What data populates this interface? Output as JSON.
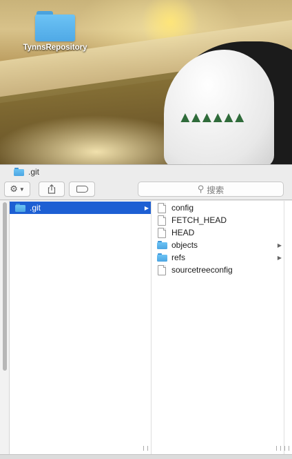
{
  "desktop": {
    "folder_label": "TynnsRepository"
  },
  "window": {
    "title": ".git",
    "toolbar": {
      "action_icon": "gear-icon",
      "share_icon": "share-icon",
      "tag_icon": "tag-icon",
      "search_placeholder": "搜索"
    },
    "columns": [
      {
        "items": [
          {
            "name": ".git",
            "kind": "folder",
            "selected": true,
            "has_children": true
          }
        ]
      },
      {
        "items": [
          {
            "name": "config",
            "kind": "file"
          },
          {
            "name": "FETCH_HEAD",
            "kind": "file"
          },
          {
            "name": "HEAD",
            "kind": "file"
          },
          {
            "name": "objects",
            "kind": "folder",
            "has_children": true
          },
          {
            "name": "refs",
            "kind": "folder",
            "has_children": true
          },
          {
            "name": "sourcetreeconfig",
            "kind": "file"
          }
        ]
      },
      {
        "items": []
      }
    ]
  },
  "colors": {
    "selection": "#1d5fd3",
    "folder_blue": "#5db5ee",
    "window_bg": "#ececec"
  }
}
